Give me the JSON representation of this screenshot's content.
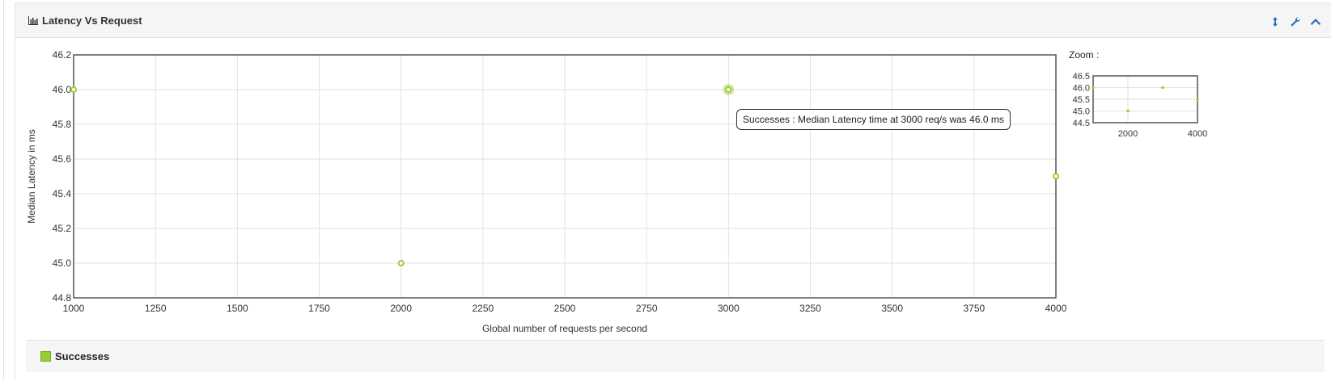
{
  "panel": {
    "title": "Latency Vs Request",
    "icons": [
      "bar-chart-icon",
      "resize-vertical-icon",
      "wrench-icon",
      "chevron-up-icon"
    ]
  },
  "chart_data": {
    "type": "scatter",
    "xlabel": "Global number of requests per second",
    "ylabel": "Median Latency in ms",
    "xlim": [
      1000,
      4000
    ],
    "ylim": [
      44.8,
      46.2
    ],
    "xticks": [
      "1000",
      "1250",
      "1500",
      "1750",
      "2000",
      "2250",
      "2500",
      "2750",
      "3000",
      "3250",
      "3500",
      "3750",
      "4000"
    ],
    "yticks": [
      "46.2",
      "46.0",
      "45.8",
      "45.6",
      "45.4",
      "45.2",
      "45.0",
      "44.8"
    ],
    "grid": true,
    "series": [
      {
        "name": "Successes",
        "color": "#9acd32",
        "points": [
          {
            "x": 1000,
            "y": 46.0
          },
          {
            "x": 2000,
            "y": 45.0
          },
          {
            "x": 3000,
            "y": 46.0
          },
          {
            "x": 4000,
            "y": 45.5
          }
        ]
      }
    ],
    "highlighted_point": {
      "x": 3000,
      "y": 46.0
    },
    "tooltip": "Successes : Median Latency time at 3000 req/s was 46.0 ms"
  },
  "zoom": {
    "label": "Zoom :",
    "xlim": [
      1000,
      4000
    ],
    "ylim": [
      44.5,
      46.5
    ],
    "xticks": [
      "2000",
      "4000"
    ],
    "yticks": [
      "46.5",
      "46.0",
      "45.5",
      "45.0",
      "44.5"
    ]
  },
  "legend": {
    "items": [
      {
        "label": "Successes",
        "color": "#9acd32"
      }
    ]
  }
}
